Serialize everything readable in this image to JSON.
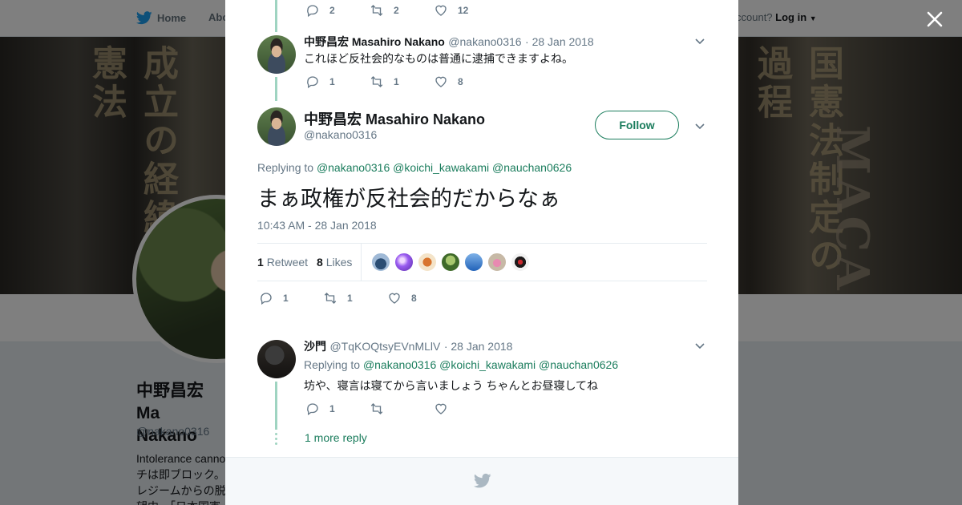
{
  "nav": {
    "home": "Home",
    "about": "Abo",
    "account_prompt": "ccount?",
    "login": "Log in"
  },
  "banner": {
    "spine_left": "成立の経緯と憲法",
    "spine_right": "国憲法制定の過程",
    "spine_far_right": "MACAR"
  },
  "profile": {
    "name": "中野昌宏 Ma Nakano",
    "handle": "@nakano0316",
    "bio": "Intolerance canno\nチは即ブロック。\nレジームからの脱\n望中。「日本国憲"
  },
  "thread": {
    "top_actions": {
      "replies": "2",
      "retweets": "2",
      "likes": "12"
    },
    "reply1": {
      "name": "中野昌宏 Masahiro Nakano",
      "handle": "@nakano0316",
      "date": "· 28 Jan 2018",
      "text": "これほど反社会的なものは普通に逮捕できますよね。",
      "replies": "1",
      "retweets": "1",
      "likes": "8"
    },
    "main": {
      "name": "中野昌宏 Masahiro Nakano",
      "handle": "@nakano0316",
      "follow": "Follow",
      "replying_prefix": "Replying to",
      "replying_to": "@nakano0316 @koichi_kawakami @nauchan0626",
      "text": "まぁ政権が反社会的だからなぁ",
      "timestamp": "10:43 AM - 28 Jan 2018",
      "retweet_count": "1",
      "retweet_label": "Retweet",
      "like_count": "8",
      "like_label": "Likes",
      "replies": "1",
      "retweets": "1",
      "likes": "8"
    },
    "reply2": {
      "name": "沙門",
      "handle": "@TqKOQtsyEVnMLlV",
      "date": "· 28 Jan 2018",
      "replying_prefix": "Replying to",
      "replying_to": "@nakano0316 @koichi_kawakami @nauchan0626",
      "text": "坊や、寝言は寝てから言いましょう ちゃんとお昼寝してね",
      "replies": "1"
    },
    "more_reply": "1 more reply"
  },
  "colors": {
    "accent": "#1b7d5d",
    "thread_line": "#9fd4c1",
    "twitter_blue": "#1da1f2"
  }
}
